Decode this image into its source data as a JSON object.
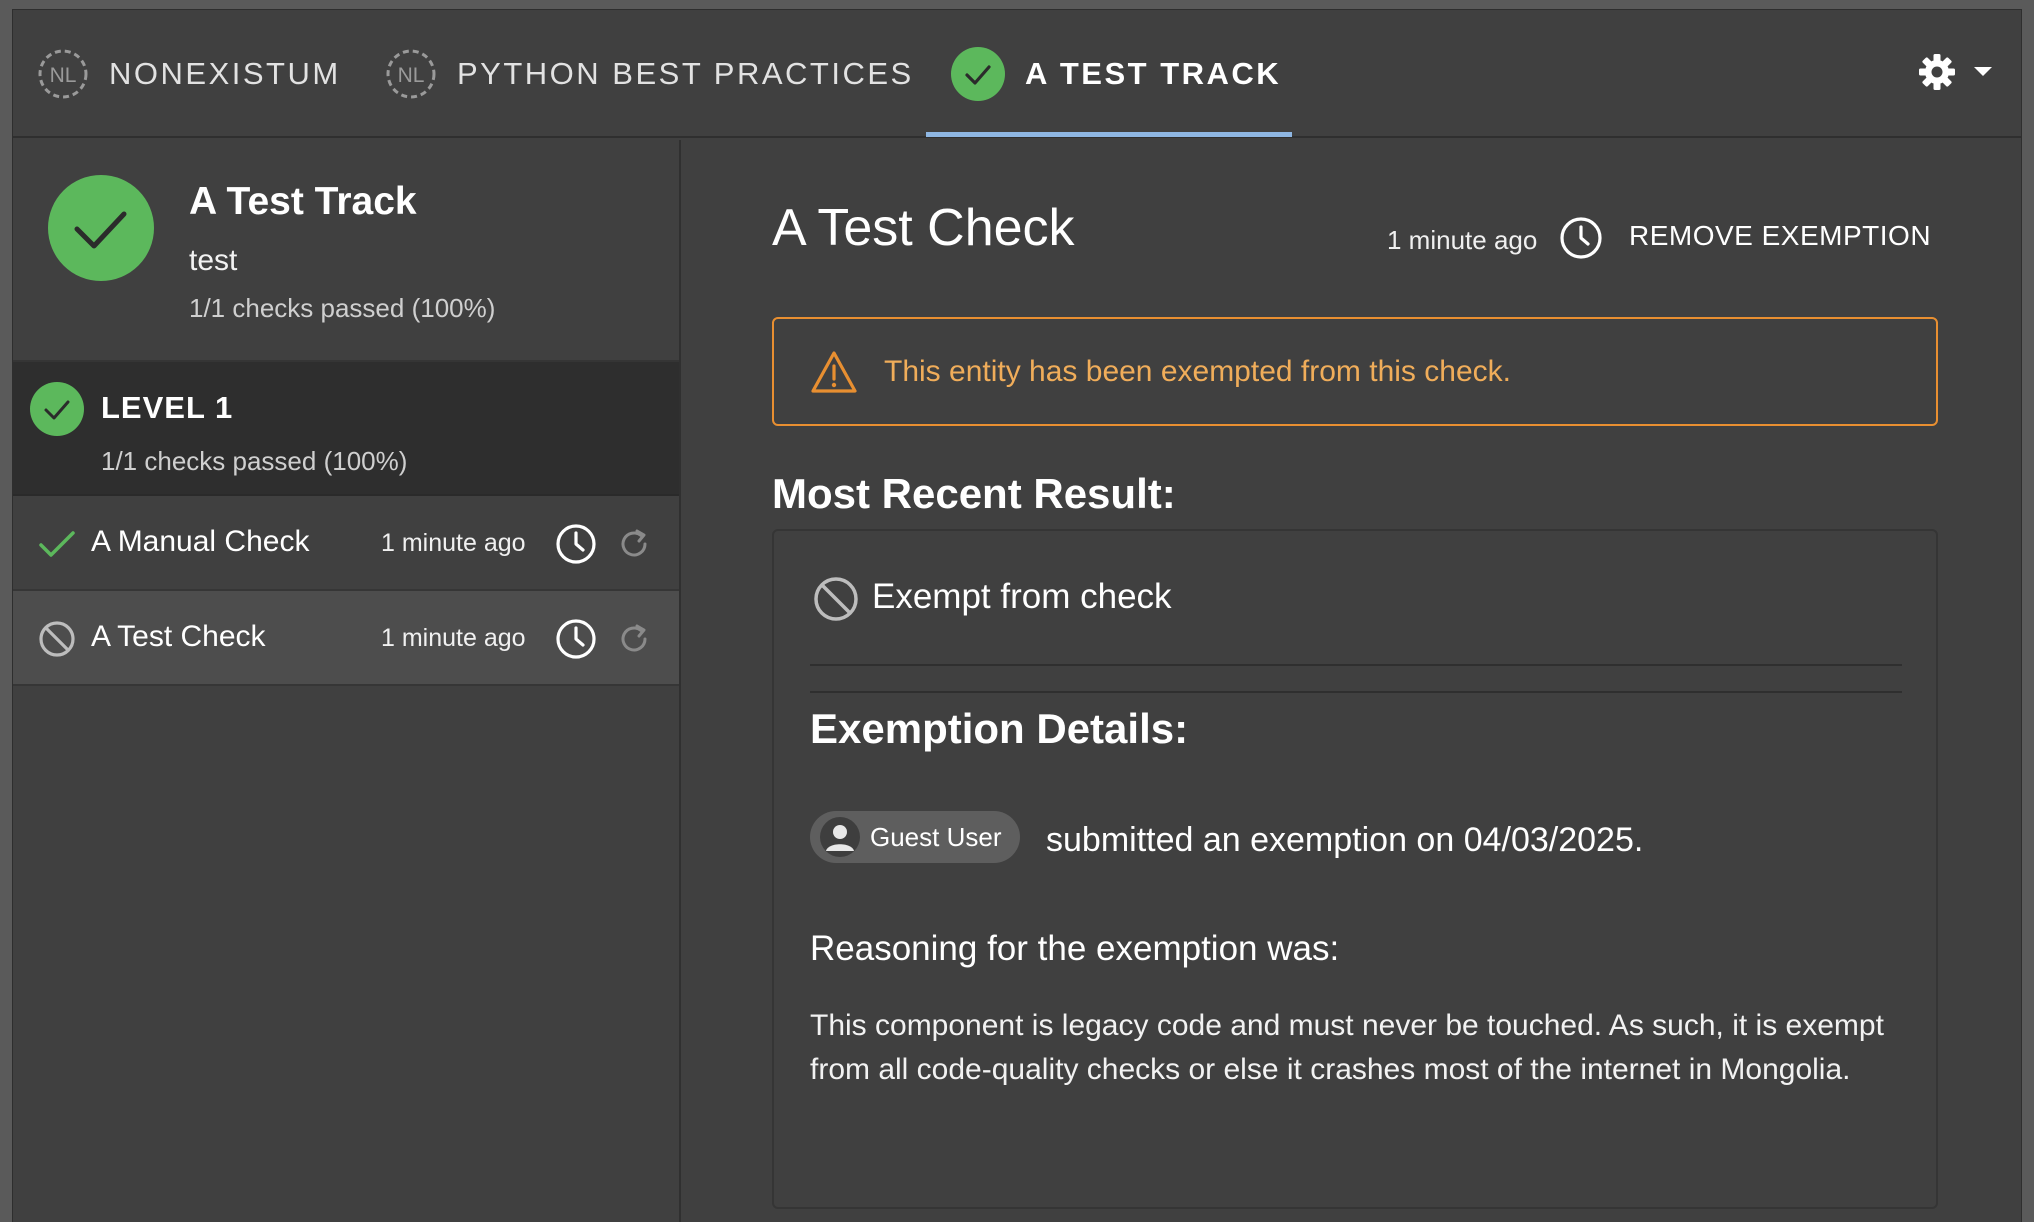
{
  "tabs": [
    {
      "label": "NONEXISTUM",
      "icon": "nl-badge-icon",
      "badge": "NL",
      "active": false
    },
    {
      "label": "PYTHON BEST PRACTICES",
      "icon": "nl-badge-icon",
      "badge": "NL",
      "active": false
    },
    {
      "label": "A TEST TRACK",
      "icon": "check-circle-icon",
      "active": true
    }
  ],
  "settings": {
    "icon": "gear-icon",
    "caret": "caret-down-icon"
  },
  "sidebar": {
    "track": {
      "title": "A Test Track",
      "subtitle": "test",
      "progress": "1/1 checks passed (100%)"
    },
    "level": {
      "title": "LEVEL 1",
      "progress": "1/1 checks passed (100%)"
    },
    "checks": [
      {
        "name": "A Manual Check",
        "time": "1 minute ago",
        "status": "passed"
      },
      {
        "name": "A Test Check",
        "time": "1 minute ago",
        "status": "exempt"
      }
    ]
  },
  "main": {
    "title": "A Test Check",
    "time": "1 minute ago",
    "remove_label": "REMOVE EXEMPTION",
    "warning": "This entity has been exempted from this check.",
    "recent_heading": "Most Recent Result:",
    "result_label": "Exempt from check",
    "details_heading": "Exemption Details:",
    "user_name": "Guest User",
    "submitted": "submitted an exemption on 04/03/2025.",
    "reasoning_label": "Reasoning for the exemption was:",
    "reasoning_text": "This component is legacy code and must never be touched. As such, it is exempt from all code-quality checks or else it crashes most of the internet in Mongolia."
  },
  "colors": {
    "success": "#5cb85c",
    "warning": "#e88f31",
    "tab_underline": "#8fb7e3",
    "background": "#404040"
  }
}
